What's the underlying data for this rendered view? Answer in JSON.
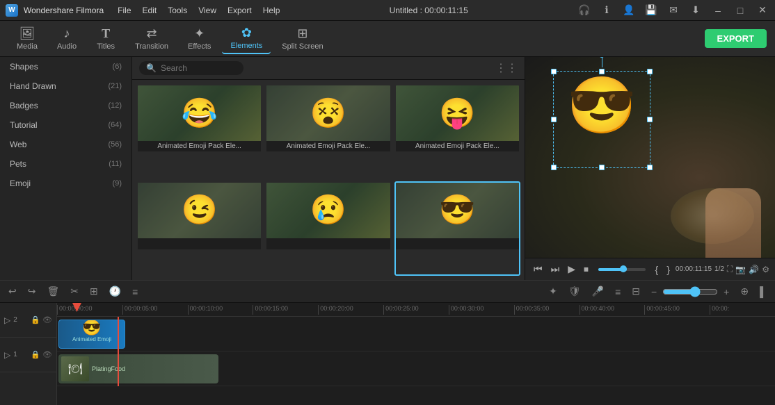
{
  "titlebar": {
    "appname": "Wondershare Filmora",
    "project": "Untitled : 00:00:11:15",
    "menus": [
      "File",
      "Edit",
      "Tools",
      "View",
      "Export",
      "Help"
    ],
    "window_btns": [
      "–",
      "□",
      "✕"
    ]
  },
  "toolbar": {
    "items": [
      {
        "id": "media",
        "icon": "🖼",
        "label": "Media"
      },
      {
        "id": "audio",
        "icon": "♪",
        "label": "Audio"
      },
      {
        "id": "titles",
        "icon": "T",
        "label": "Titles"
      },
      {
        "id": "transition",
        "icon": "⇄",
        "label": "Transition"
      },
      {
        "id": "effects",
        "icon": "✦",
        "label": "Effects"
      },
      {
        "id": "elements",
        "icon": "✿",
        "label": "Elements",
        "active": true
      },
      {
        "id": "splitscreen",
        "icon": "⊞",
        "label": "Split Screen"
      }
    ],
    "export_label": "EXPORT"
  },
  "sidebar": {
    "items": [
      {
        "label": "Shapes",
        "count": 6
      },
      {
        "label": "Hand Drawn",
        "count": 21
      },
      {
        "label": "Badges",
        "count": 12
      },
      {
        "label": "Tutorial",
        "count": 64
      },
      {
        "label": "Web",
        "count": 56
      },
      {
        "label": "Pets",
        "count": 11
      },
      {
        "label": "Emoji",
        "count": 9
      }
    ]
  },
  "search": {
    "placeholder": "Search"
  },
  "media_grid": {
    "items": [
      {
        "emoji": "😂",
        "label": "Animated Emoji Pack Ele..."
      },
      {
        "emoji": "😵",
        "label": "Animated Emoji Pack Ele..."
      },
      {
        "emoji": "😝",
        "label": "Animated Emoji Pack Ele..."
      },
      {
        "emoji": "😉",
        "label": ""
      },
      {
        "emoji": "😢",
        "label": ""
      },
      {
        "emoji": "😎",
        "label": "",
        "selected": true
      }
    ]
  },
  "preview": {
    "emoji": "😎",
    "time": "00:00:11:15"
  },
  "playback": {
    "speed": "1/2",
    "time": "00:00:11:15",
    "btns": [
      "⏮",
      "⏭",
      "▶",
      "⏹"
    ]
  },
  "timeline": {
    "toolbar_tools": [
      "↩",
      "↪",
      "🗑",
      "✂",
      "⊞",
      "🕐",
      "≡"
    ],
    "right_tools": [
      "✦",
      "🛡",
      "🎤",
      "≡",
      "⊟",
      "⊕"
    ],
    "zoom_label": "-",
    "zoom_label2": "+",
    "ruler_marks": [
      "00:00:00:00",
      "00:00:05:00",
      "00:00:10:00",
      "00:00:15:00",
      "00:00:20:00",
      "00:00:25:00",
      "00:00:30:00",
      "00:00:35:00",
      "00:00:40:00",
      "00:00:45:00",
      "00:00:"
    ],
    "tracks": [
      {
        "type": "emoji",
        "icon": "▷",
        "label": "2",
        "clip_emoji": "😎",
        "clip_label": "Animated Emoji"
      },
      {
        "type": "video",
        "icon": "▷",
        "label": "1",
        "clip_label": "PlatingFood",
        "clip_thumb": "🍽"
      }
    ]
  }
}
